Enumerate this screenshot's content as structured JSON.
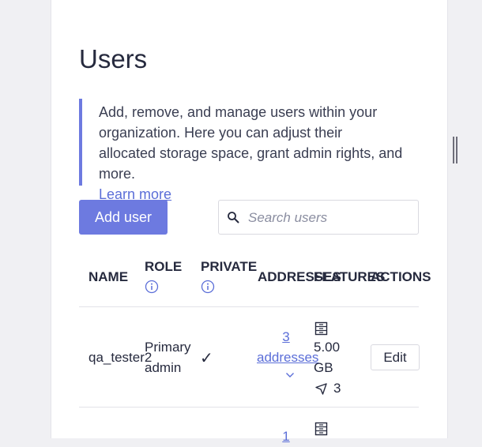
{
  "page": {
    "title": "Users",
    "info": {
      "text": "Add, remove, and manage users within your organization. Here you can adjust their allocated storage space, grant admin rights, and more.",
      "link": "Learn more"
    },
    "add_user_label": "Add user",
    "search": {
      "placeholder": "Search users",
      "value": ""
    }
  },
  "table": {
    "headers": {
      "name": "NAME",
      "role": "ROLE",
      "private": "PRIVATE",
      "addresses": "ADDRESSES",
      "features": "FEATURES",
      "actions": "ACTIONS"
    },
    "rows": [
      {
        "name": "qa_tester2",
        "role_line1": "Primary",
        "role_line2": "admin",
        "private_mark": "✓",
        "addresses_count": "3",
        "addresses_word": "addresses",
        "storage_value": "5.00",
        "storage_unit": "GB",
        "vpn_count": "3",
        "action": "Edit"
      },
      {
        "addresses_count": "1"
      }
    ]
  },
  "colors": {
    "accent": "#6d7ae0",
    "link": "#5b6ed8",
    "text": "#262a3e"
  }
}
